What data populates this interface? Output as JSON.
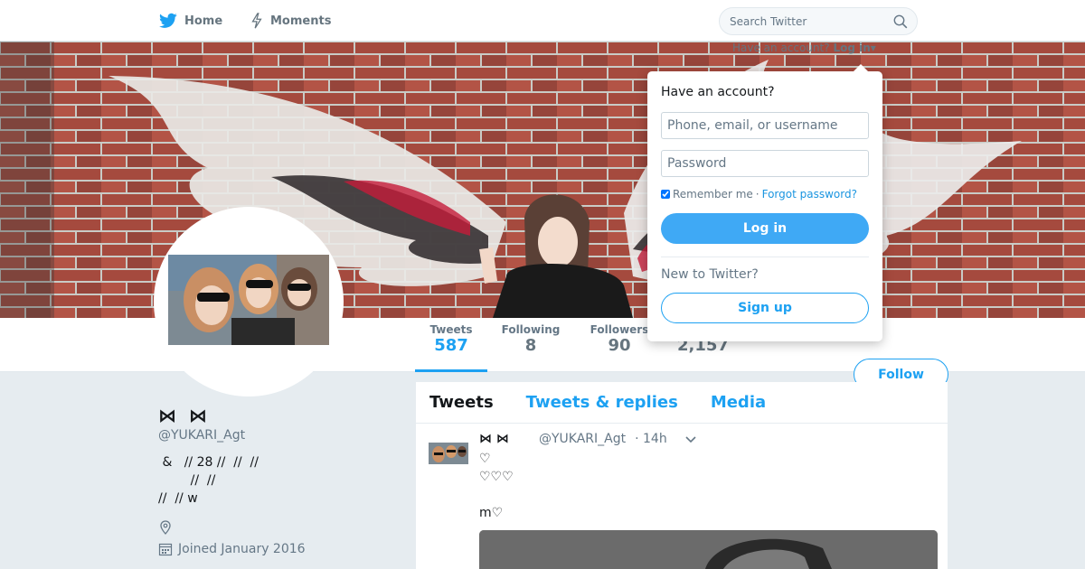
{
  "nav": {
    "home_label": "Home",
    "moments_label": "Moments",
    "search_placeholder": "Search Twitter",
    "account_prompt": "Have an account?",
    "login_link": "Log in"
  },
  "profile": {
    "name": "⋈ ︎︎︎︎︎ ⋈",
    "handle": "@YUKARI_Agt",
    "bio": " &   // 28 //  //  //\n        //  //\n//  // w",
    "joined": "Joined January 2016"
  },
  "stats": {
    "tweets_label": "Tweets",
    "tweets_value": "587",
    "following_label": "Following",
    "following_value": "8",
    "followers_label": "Followers",
    "followers_value": "90",
    "likes_value": "2,157"
  },
  "follow_label": "Follow",
  "timeline": {
    "tabs": [
      {
        "label": "Tweets"
      },
      {
        "label": "Tweets & replies"
      },
      {
        "label": "Media"
      }
    ]
  },
  "tweet": {
    "name": "⋈  ⋈",
    "handle": "@YUKARI_Agt",
    "time": "· 14h",
    "text": "♡\n♡♡♡\n\nm♡"
  },
  "login_popup": {
    "title": "Have an account?",
    "username_placeholder": "Phone, email, or username",
    "password_placeholder": "Password",
    "remember_label": "Remember me",
    "separator": "·",
    "forgot_label": "Forgot password?",
    "login_button": "Log in",
    "new_prompt": "New to Twitter?",
    "signup_button": "Sign up"
  },
  "colors": {
    "accent": "#1da1f2",
    "login_button": "#3fa9f5",
    "page_background": "#e6ecf0"
  }
}
